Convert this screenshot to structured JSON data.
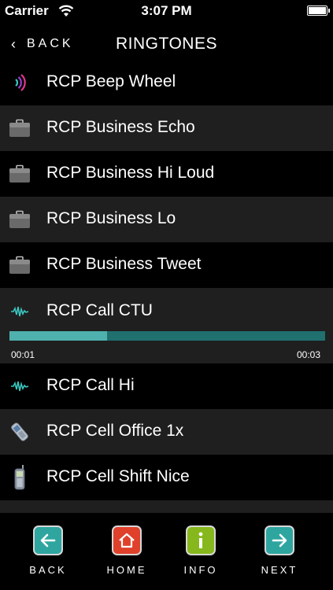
{
  "status_bar": {
    "carrier": "Carrier",
    "time": "3:07 PM"
  },
  "nav": {
    "back_label": "BACK",
    "title": "RINGTONES"
  },
  "ringtones": [
    {
      "label": "RCP Beep Wheel",
      "icon": "sound-waves-icon"
    },
    {
      "label": "RCP Business Echo",
      "icon": "briefcase-icon"
    },
    {
      "label": "RCP Business Hi Loud",
      "icon": "briefcase-icon"
    },
    {
      "label": "RCP Business Lo",
      "icon": "briefcase-icon"
    },
    {
      "label": "RCP Business Tweet",
      "icon": "briefcase-icon"
    },
    {
      "label": "RCP Call CTU",
      "icon": "waveform-icon",
      "playing": true
    },
    {
      "label": "RCP Call Hi",
      "icon": "waveform-icon"
    },
    {
      "label": "RCP Cell Office 1x",
      "icon": "cell-phone-icon"
    },
    {
      "label": "RCP Cell Shift Nice",
      "icon": "mobile-phone-icon"
    }
  ],
  "player": {
    "elapsed": "00:01",
    "duration": "00:03",
    "progress": 0.31
  },
  "tabs": [
    {
      "label": "BACK",
      "icon": "arrow-left-icon",
      "color": "#2fa5a0"
    },
    {
      "label": "HOME",
      "icon": "home-icon",
      "color": "#e0412b"
    },
    {
      "label": "INFO",
      "icon": "info-icon",
      "color": "#86b81d"
    },
    {
      "label": "NEXT",
      "icon": "arrow-right-icon",
      "color": "#2fa5a0"
    }
  ],
  "colors": {
    "row_alt": "#1f1f1f",
    "progress_track": "#207070",
    "progress_fill": "#4fb1ae"
  }
}
